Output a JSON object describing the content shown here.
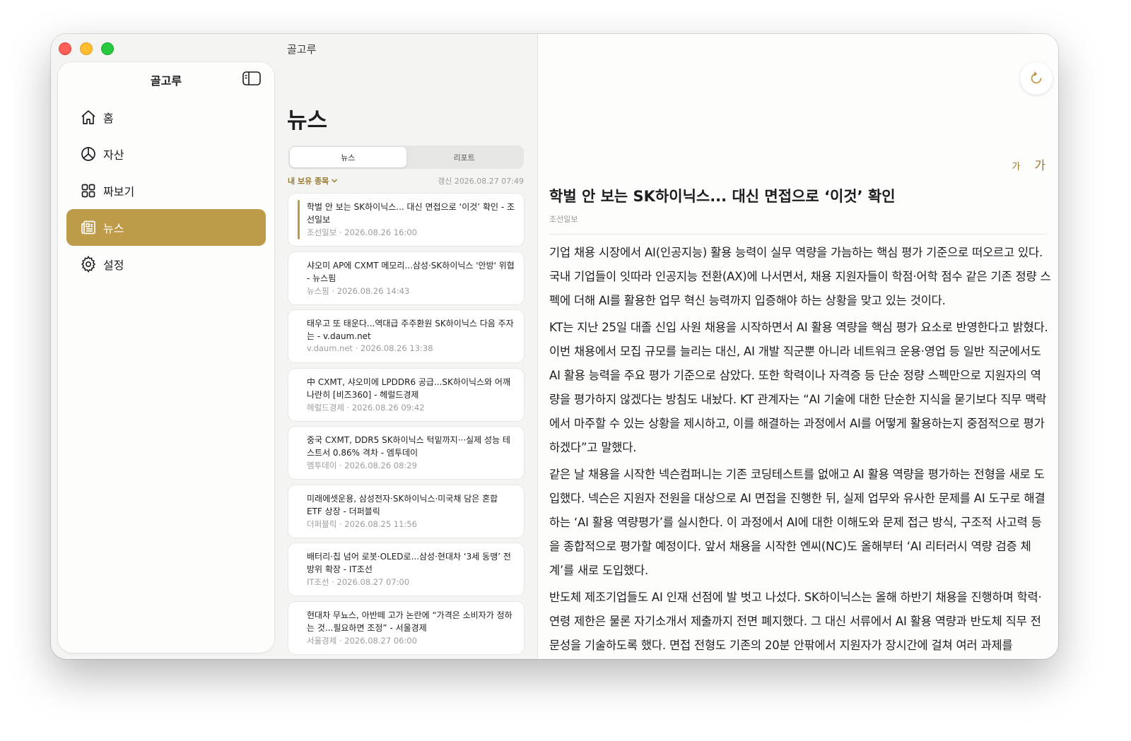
{
  "window": {
    "title": "골고루"
  },
  "sidebar": {
    "title": "골고루",
    "items": [
      {
        "label": "홈",
        "icon": "home-icon",
        "active": false
      },
      {
        "label": "자산",
        "icon": "pie-chart-icon",
        "active": false
      },
      {
        "label": "짜보기",
        "icon": "grid-icon",
        "active": false
      },
      {
        "label": "뉴스",
        "icon": "newspaper-icon",
        "active": true
      },
      {
        "label": "설정",
        "icon": "gear-icon",
        "active": false
      }
    ]
  },
  "list": {
    "title": "뉴스",
    "tabs": [
      {
        "label": "뉴스",
        "active": true
      },
      {
        "label": "리포트",
        "active": false
      }
    ],
    "filter": "내 보유 종목",
    "updated": "갱신 2026.08.27 07:49",
    "items": [
      {
        "title": "학벌 안 보는 SK하이닉스... 대신 면접으로 ‘이것’ 확인 - 조선일보",
        "meta": "조선일보 · 2026.08.26 16:00",
        "selected": true
      },
      {
        "title": "샤오미 AP에 CXMT 메모리...삼성·SK하이닉스 '안방' 위협 - 뉴스핌",
        "meta": "뉴스핌 · 2026.08.26 14:43",
        "selected": false
      },
      {
        "title": "태우고 또 태운다...역대급 주주환원 SK하이닉스 다음 주자는 - v.daum.net",
        "meta": "v.daum.net · 2026.08.26 13:38",
        "selected": false
      },
      {
        "title": "中 CXMT, 샤오미에 LPDDR6 공급...SK하이닉스와 어깨 나란히 [비즈360] - 헤럴드경제",
        "meta": "헤럴드경제 · 2026.08.26 09:42",
        "selected": false
      },
      {
        "title": "중국 CXMT, DDR5 SK하이닉스 턱밑까지···실제 성능 테스트서 0.86% 격차 - 엠투데이",
        "meta": "엠투데이 · 2026.08.26 08:29",
        "selected": false
      },
      {
        "title": "미래에셋운용, 삼성전자·SK하이닉스·미국채 담은 혼합 ETF 상장 - 더퍼블릭",
        "meta": "더퍼블릭 · 2026.08.25 11:56",
        "selected": false
      },
      {
        "title": "배터리·칩 넘어 로봇·OLED로...삼성·현대차 ‘3세 동맹’ 전방위 확장 - IT조선",
        "meta": "IT조선 · 2026.08.27 07:00",
        "selected": false
      },
      {
        "title": "현대차 무뇨스, 아반떼 고가 논란에 “가격은 소비자가 정하는 것...필요하면 조정” - 서울경제",
        "meta": "서울경제 · 2026.08.27 06:00",
        "selected": false
      }
    ]
  },
  "detail": {
    "font_small": "가",
    "font_large": "가",
    "title": "학벌 안 보는 SK하이닉스... 대신 면접으로 ‘이것’ 확인",
    "source": "조선일보",
    "paragraphs": [
      "기업 채용 시장에서 AI(인공지능) 활용 능력이 실무 역량을 가늠하는 핵심 평가 기준으로 떠오르고 있다. 국내 기업들이 잇따라 인공지능 전환(AX)에 나서면서, 채용 지원자들이 학점·어학 점수 같은 기존 정량 스펙에 더해 AI를 활용한 업무 혁신 능력까지 입증해야 하는 상황을 맞고 있는 것이다.",
      "KT는 지난 25일 대졸 신입 사원 채용을 시작하면서 AI 활용 역량을 핵심 평가 요소로 반영한다고 밝혔다. 이번 채용에서 모집 규모를 늘리는 대신, AI 개발 직군뿐 아니라 네트워크 운용·영업 등 일반 직군에서도 AI 활용 능력을 주요 평가 기준으로 삼았다. 또한 학력이나 자격증 등 단순 정량 스펙만으로 지원자의 역량을 평가하지 않겠다는 방침도 내놨다. KT 관계자는 “AI 기술에 대한 단순한 지식을 묻기보다 직무 맥락에서 마주할 수 있는 상황을 제시하고, 이를 해결하는 과정에서 AI를 어떻게 활용하는지 중점적으로 평가하겠다”고 말했다.",
      "같은 날 채용을 시작한 넥슨컴퍼니는 기존 코딩테스트를 없애고 AI 활용 역량을 평가하는 전형을 새로 도입했다. 넥슨은 지원자 전원을 대상으로 AI 면접을 진행한 뒤, 실제 업무와 유사한 문제를 AI 도구로 해결하는 ‘AI 활용 역량평가’를 실시한다. 이 과정에서 AI에 대한 이해도와 문제 접근 방식, 구조적 사고력 등을 종합적으로 평가할 예정이다. 앞서 채용을 시작한 엔씨(NC)도 올해부터 ‘AI 리터러시 역량 검증 체계’를 새로 도입했다.",
      "반도체 제조기업들도 AI 인재 선점에 발 벗고 나섰다. SK하이닉스는 올해 하반기 채용을 진행하며 학력·연령 제한은 물론 자기소개서 제출까지 전면 폐지했다. 그 대신 서류에서 AI 활용 역량과 반도체 직무 전문성을 기술하도록 했다. 면접 전형도 기존의 20분 안팎에서 지원자가 장시간에 걸쳐 여러 과제를"
    ]
  }
}
